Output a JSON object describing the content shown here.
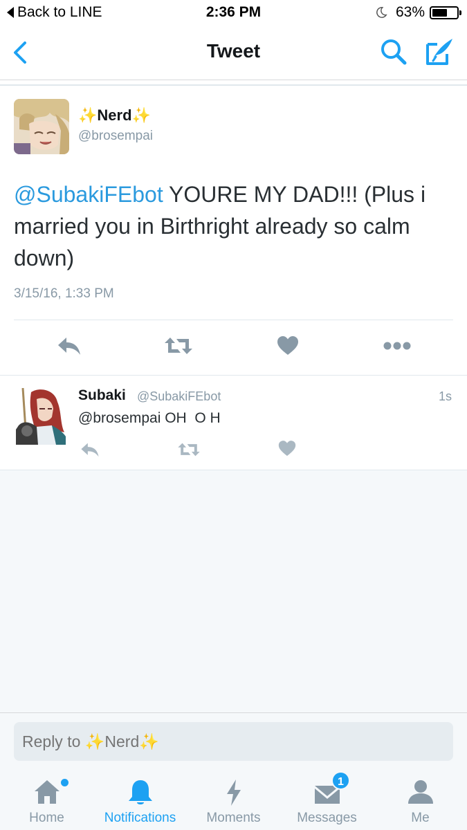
{
  "status_bar": {
    "back_label": "Back to LINE",
    "time": "2:36 PM",
    "battery": "63%",
    "battery_level": 0.63
  },
  "nav": {
    "title": "Tweet"
  },
  "main_tweet": {
    "author_name": "✨Nerd✨",
    "author_handle": "@brosempai",
    "mention": "@SubakiFEbot",
    "text": " YOURE MY DAD!!! (Plus i married you in Birthright already so calm down)",
    "date": "3/15/16, 1:33 PM"
  },
  "reply_tweet": {
    "author_name": "Subaki",
    "author_handle": "@SubakiFEbot",
    "time": "1s",
    "text": "@brosempai OH  O H"
  },
  "composer": {
    "placeholder": "Reply to ✨Nerd✨"
  },
  "tabs": [
    {
      "label": "Home",
      "icon": "home-icon"
    },
    {
      "label": "Notifications",
      "icon": "bell-icon"
    },
    {
      "label": "Moments",
      "icon": "lightning-icon"
    },
    {
      "label": "Messages",
      "icon": "envelope-icon",
      "badge": "1"
    },
    {
      "label": "Me",
      "icon": "person-icon"
    }
  ],
  "colors": {
    "accent": "#1da1f2",
    "mention": "#2b9ade",
    "secondary_text": "#8899a6",
    "icon_gray": "#8899a6"
  }
}
